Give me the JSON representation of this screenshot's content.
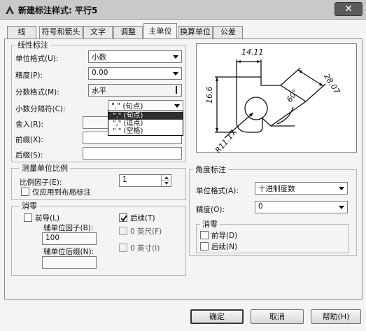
{
  "window": {
    "title": "新建标注样式: 平行5",
    "close_glyph": "✕"
  },
  "tabs": [
    {
      "label": "线"
    },
    {
      "label": "符号和箭头"
    },
    {
      "label": "文字"
    },
    {
      "label": "调整"
    },
    {
      "label": "主单位",
      "active": true
    },
    {
      "label": "换算单位"
    },
    {
      "label": "公差"
    }
  ],
  "linear": {
    "group_label": "线性标注",
    "unit_format_label": "单位格式(U):",
    "unit_format_value": "小数",
    "precision_label": "精度(P):",
    "precision_value": "0.00",
    "fraction_format_label": "分数格式(M):",
    "fraction_format_value": "水平",
    "decimal_sep_label": "小数分隔符(C):",
    "decimal_sep_value": "\".\" (句点)",
    "decimal_sep_options": [
      "\".\" (句点)",
      "\",\" (逗点)",
      "\" \" (空格)"
    ],
    "roundoff_label": "舍入(R):",
    "prefix_label": "前缀(X):",
    "suffix_label": "后缀(S):"
  },
  "scale": {
    "group_label": "测量单位比例",
    "factor_label": "比例因子(E):",
    "factor_value": "1",
    "layout_only_label": "仅应用到布局标注"
  },
  "zero_supp": {
    "group_label": "消零",
    "leading_label": "前导(L)",
    "trailing_label": "后续(T)",
    "sub_factor_label": "辅单位因子(B):",
    "sub_factor_value": "100",
    "feet_label": "0 英尺(F)",
    "sub_suffix_label": "辅单位后缀(N):",
    "inches_label": "0 英寸(I)"
  },
  "angular": {
    "group_label": "角度标注",
    "unit_format_label": "单位格式(A):",
    "unit_format_value": "十进制度数",
    "precision_label": "精度(O):",
    "precision_value": "0",
    "zero_group_label": "消零",
    "leading_label": "前导(D)",
    "trailing_label": "后续(N)"
  },
  "preview": {
    "dim_top": "14.11",
    "dim_left": "16.6",
    "dim_right": "28.07",
    "dim_angle": "60°",
    "dim_radius": "R11.17"
  },
  "buttons": {
    "ok": "确定",
    "cancel": "取消",
    "help": "帮助(H)"
  }
}
